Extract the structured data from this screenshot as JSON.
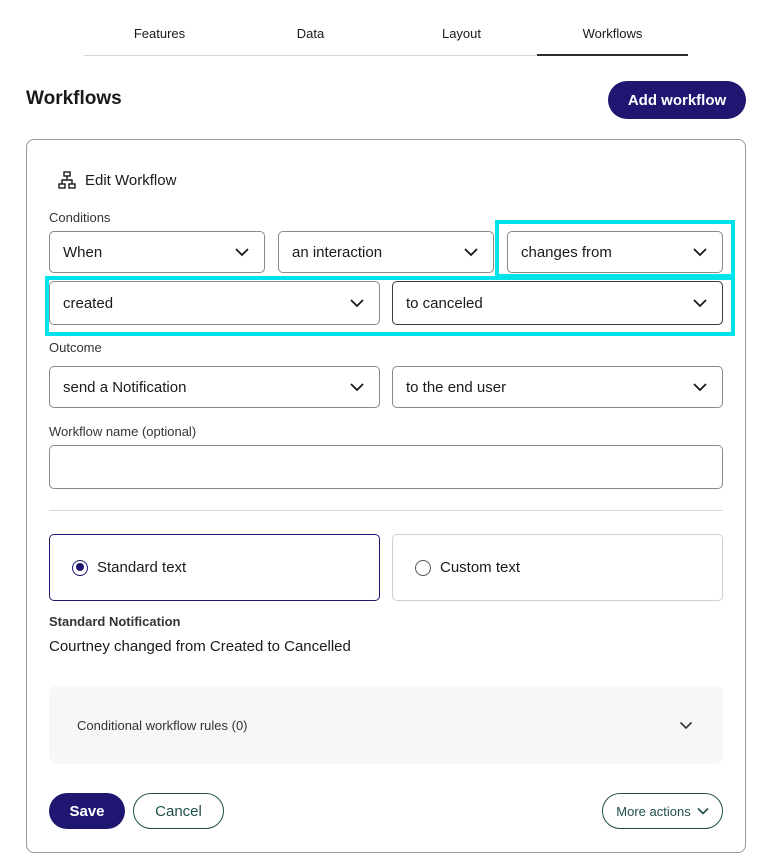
{
  "tabs": [
    {
      "label": "Features"
    },
    {
      "label": "Data"
    },
    {
      "label": "Layout"
    },
    {
      "label": "Workflows",
      "active": true
    }
  ],
  "header": {
    "title": "Workflows",
    "add_button": "Add workflow"
  },
  "edit": {
    "title": "Edit Workflow",
    "conditions_label": "Conditions",
    "conditions": {
      "when": "When",
      "subject": "an interaction",
      "event": "changes from",
      "from_status": "created",
      "to_status": "to canceled"
    },
    "outcome_label": "Outcome",
    "outcome": {
      "action": "send a Notification",
      "target": "to the end user"
    },
    "name_label": "Workflow name (optional)",
    "name_value": "",
    "text_options": [
      {
        "label": "Standard text",
        "selected": true
      },
      {
        "label": "Custom text",
        "selected": false
      }
    ],
    "standard_label": "Standard Notification",
    "standard_text": "Courtney changed from Created to Cancelled",
    "conditional_rules": "Conditional workflow rules (0)"
  },
  "footer": {
    "save": "Save",
    "cancel": "Cancel",
    "more": "More actions"
  },
  "colors": {
    "primary": "#1f1672",
    "highlight": "#00e3ea",
    "secondary_border": "#1f4f4a"
  }
}
